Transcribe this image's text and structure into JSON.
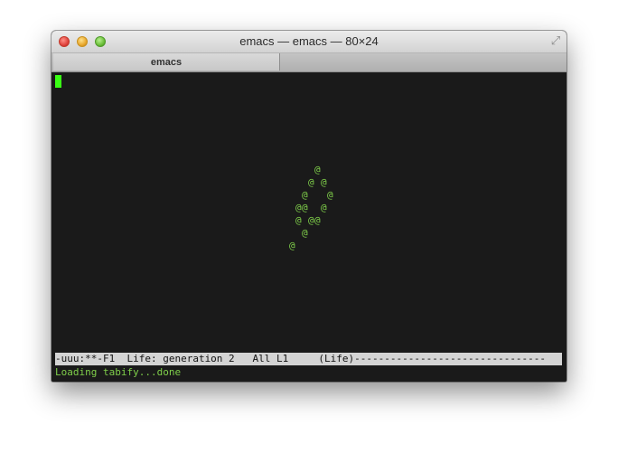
{
  "window": {
    "title": "emacs — emacs — 80×24",
    "tab_label": "emacs",
    "traffic_lights": [
      "close-icon",
      "minimize-icon",
      "zoom-icon"
    ],
    "fullscreen_icon": "fullscreen-icon"
  },
  "terminal": {
    "background": "#1a1a1a",
    "text_color": "#7fcf4a",
    "cursor_color": "#39ff14",
    "life_cells": [
      {
        "row": 0,
        "col": 4
      },
      {
        "row": 1,
        "col": 3
      },
      {
        "row": 1,
        "col": 5
      },
      {
        "row": 2,
        "col": 2
      },
      {
        "row": 2,
        "col": 6
      },
      {
        "row": 3,
        "col": 1
      },
      {
        "row": 3,
        "col": 2
      },
      {
        "row": 3,
        "col": 5
      },
      {
        "row": 4,
        "col": 1
      },
      {
        "row": 4,
        "col": 3
      },
      {
        "row": 4,
        "col": 4
      },
      {
        "row": 5,
        "col": 2
      },
      {
        "row": 6,
        "col": 0
      }
    ],
    "cell_char": "@",
    "modeline": "-uuu:**-F1  Life: generation 2   All L1     (Life)--------------------------------",
    "echo_area": "Loading tabify...done"
  }
}
